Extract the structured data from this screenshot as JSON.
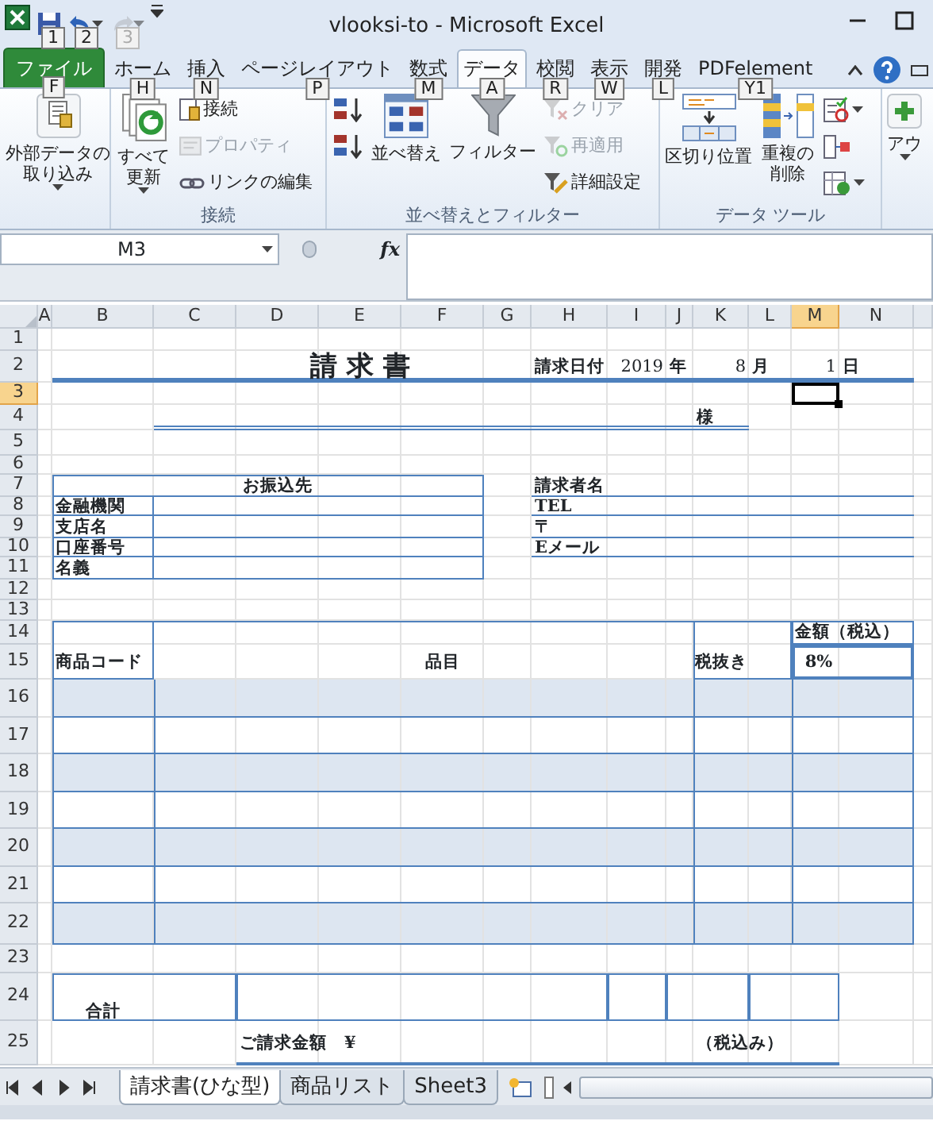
{
  "title_bar": {
    "title": "vlooksi-to - Microsoft Excel",
    "quick_access": [
      {
        "kind": "save",
        "key_tip": "1",
        "disabled": false
      },
      {
        "kind": "undo",
        "key_tip": "2",
        "disabled": false
      },
      {
        "kind": "redo",
        "key_tip": "3",
        "disabled": true
      }
    ]
  },
  "ribbon_tabs": [
    {
      "kind": "file",
      "label": "ファイル",
      "key_tip": "F",
      "selected": false
    },
    {
      "kind": "tab",
      "label": "ホーム",
      "key_tip": "H",
      "selected": false
    },
    {
      "kind": "tab",
      "label": "挿入",
      "key_tip": "N",
      "selected": false
    },
    {
      "kind": "tab",
      "label": "ページレイアウト",
      "key_tip": "P",
      "selected": false
    },
    {
      "kind": "tab",
      "label": "数式",
      "key_tip": "M",
      "selected": false
    },
    {
      "kind": "tab",
      "label": "データ",
      "key_tip": "A",
      "selected": true
    },
    {
      "kind": "tab",
      "label": "校閲",
      "key_tip": "R",
      "selected": false
    },
    {
      "kind": "tab",
      "label": "表示",
      "key_tip": "W",
      "selected": false
    },
    {
      "kind": "tab",
      "label": "開発",
      "key_tip": "L",
      "selected": false
    },
    {
      "kind": "tab",
      "label": "PDFelement",
      "key_tip": "Y1",
      "selected": false
    }
  ],
  "ribbon_groups": [
    {
      "controls": [
        {
          "kind": "large",
          "label": "外部データの取り込み",
          "dropdown": true
        }
      ]
    },
    {
      "label": "接続",
      "controls": [
        {
          "kind": "large",
          "label": "すべて更新",
          "dropdown": true
        },
        {
          "kind": "stack",
          "items": [
            {
              "label": "接続",
              "disabled": false
            },
            {
              "label": "プロパティ",
              "disabled": true
            },
            {
              "label": "リンクの編集",
              "disabled": false
            }
          ]
        }
      ]
    },
    {
      "label": "並べ替えとフィルター",
      "controls": [
        {
          "kind": "stack",
          "items": [
            {
              "disabled": false
            },
            {
              "disabled": false
            }
          ]
        },
        {
          "kind": "large",
          "label": "並べ替え"
        },
        {
          "kind": "large",
          "label": "フィルター"
        },
        {
          "kind": "stack",
          "items": [
            {
              "label": "クリア",
              "disabled": true
            },
            {
              "label": "再適用",
              "disabled": true
            },
            {
              "label": "詳細設定",
              "disabled": false
            }
          ]
        }
      ]
    },
    {
      "label": "データ ツール",
      "controls": [
        {
          "kind": "large",
          "label": "区切り位置"
        },
        {
          "kind": "large",
          "label": "重複の削除"
        },
        {
          "kind": "stack",
          "items": [
            {
              "dropdown": true,
              "disabled": false
            },
            {
              "disabled": false
            },
            {
              "dropdown": true,
              "disabled": false
            }
          ]
        }
      ]
    },
    {
      "controls": [
        {
          "kind": "large",
          "label": "アウ",
          "dropdown": true
        }
      ]
    }
  ],
  "formula_bar": {
    "name_box": "M3",
    "function_label": "fx"
  },
  "sheet": {
    "columns": [
      {
        "label": "A",
        "selected": false
      },
      {
        "label": "B",
        "selected": false
      },
      {
        "label": "C",
        "selected": false
      },
      {
        "label": "D",
        "selected": false
      },
      {
        "label": "E",
        "selected": false
      },
      {
        "label": "F",
        "selected": false
      },
      {
        "label": "G",
        "selected": false
      },
      {
        "label": "H",
        "selected": false
      },
      {
        "label": "I",
        "selected": false
      },
      {
        "label": "J",
        "selected": false
      },
      {
        "label": "K",
        "selected": false
      },
      {
        "label": "L",
        "selected": false
      },
      {
        "label": "M",
        "selected": true
      },
      {
        "label": "N",
        "selected": false
      }
    ],
    "rows": [
      {
        "label": "1",
        "selected": false,
        "cells": []
      },
      {
        "label": "2",
        "selected": false,
        "cells": [
          "",
          "",
          "",
          "",
          "請 求 書",
          "",
          "",
          "請求日付",
          "2019",
          "年",
          "8",
          "月",
          "1",
          "日"
        ]
      },
      {
        "label": "3",
        "selected": true,
        "cells": []
      },
      {
        "label": "4",
        "selected": false,
        "cells": [
          "",
          "",
          "",
          "",
          "",
          "",
          "",
          "",
          "",
          "",
          "様"
        ]
      },
      {
        "label": "5",
        "selected": false,
        "cells": []
      },
      {
        "label": "6",
        "selected": false,
        "cells": []
      },
      {
        "label": "7",
        "selected": false,
        "cells": [
          "",
          "",
          "",
          "お振込先",
          "",
          "",
          "",
          "請求者名"
        ]
      },
      {
        "label": "8",
        "selected": false,
        "cells": [
          "",
          "金融機関",
          "",
          "",
          "",
          "",
          "",
          "TEL"
        ]
      },
      {
        "label": "9",
        "selected": false,
        "cells": [
          "",
          "支店名",
          "",
          "",
          "",
          "",
          "",
          "〒"
        ]
      },
      {
        "label": "10",
        "selected": false,
        "cells": [
          "",
          "口座番号",
          "",
          "",
          "",
          "",
          "",
          "Eメール"
        ]
      },
      {
        "label": "11",
        "selected": false,
        "cells": [
          "",
          "名義"
        ]
      },
      {
        "label": "12",
        "selected": false,
        "cells": []
      },
      {
        "label": "13",
        "selected": false,
        "cells": []
      },
      {
        "label": "14",
        "selected": false,
        "cells": [
          "",
          "",
          "",
          "",
          "",
          "",
          "",
          "",
          "",
          "",
          "",
          "",
          "金額（税込）"
        ]
      },
      {
        "label": "15",
        "selected": false,
        "cells": [
          "",
          "商品コード",
          "",
          "",
          "",
          "品目",
          "",
          "",
          "",
          "",
          "税抜き",
          "",
          "8%"
        ]
      },
      {
        "label": "16",
        "selected": false,
        "cells": []
      },
      {
        "label": "17",
        "selected": false,
        "cells": []
      },
      {
        "label": "18",
        "selected": false,
        "cells": []
      },
      {
        "label": "19",
        "selected": false,
        "cells": []
      },
      {
        "label": "20",
        "selected": false,
        "cells": []
      },
      {
        "label": "21",
        "selected": false,
        "cells": []
      },
      {
        "label": "22",
        "selected": false,
        "cells": []
      },
      {
        "label": "23",
        "selected": false,
        "cells": []
      },
      {
        "label": "24",
        "selected": false,
        "cells": [
          "",
          "合計"
        ]
      },
      {
        "label": "25",
        "selected": false,
        "cells": [
          "",
          "",
          "",
          "ご請求金額　¥",
          "",
          "",
          "",
          "",
          "",
          "",
          "（税込み）"
        ]
      }
    ]
  },
  "sheet_tabs": [
    {
      "label": "請求書(ひな型)",
      "selected": true
    },
    {
      "label": "商品リスト",
      "selected": false
    },
    {
      "label": "Sheet3",
      "selected": false
    }
  ]
}
